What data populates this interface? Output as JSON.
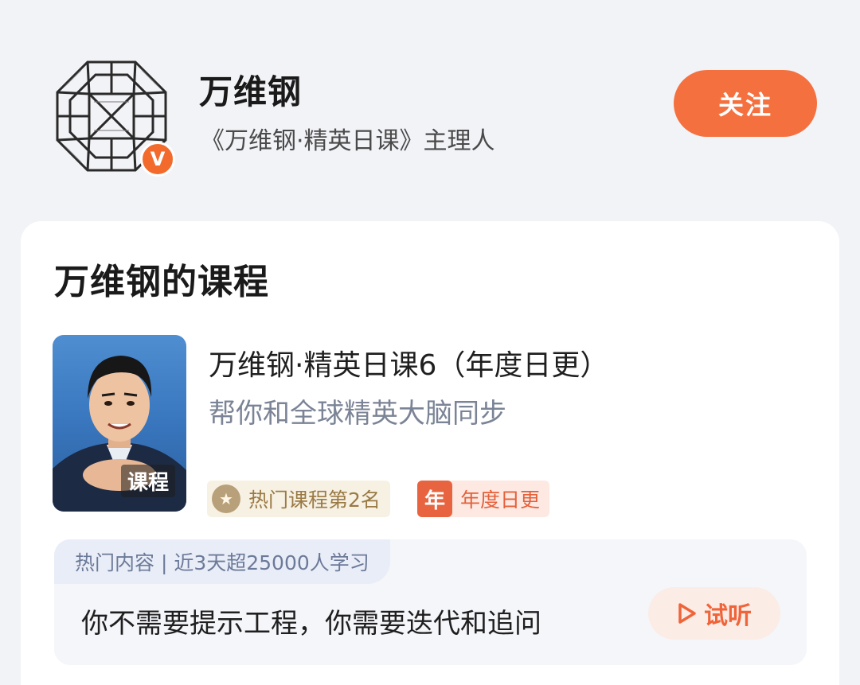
{
  "author": {
    "name": "万维钢",
    "role": "《万维钢·精英日课》主理人",
    "verified_mark": "V",
    "follow_label": "关注",
    "avatar_icon": "rhombicuboctahedron-sketch-icon"
  },
  "section": {
    "title": "万维钢的课程"
  },
  "course": {
    "cover_badge": "课程",
    "title": "万维钢·精英日课6（年度日更）",
    "subtitle": "帮你和全球精英大脑同步",
    "rank_tag": "热门课程第2名",
    "year_tag_mark": "年",
    "year_tag": "年度日更"
  },
  "hot": {
    "header": "热门内容 | 近3天超25000人学习",
    "text": "你不需要提示工程，你需要迭代和追问",
    "listen_label": "试听"
  },
  "colors": {
    "accent": "#f5703f",
    "background": "#f2f3f7",
    "card": "#ffffff"
  }
}
